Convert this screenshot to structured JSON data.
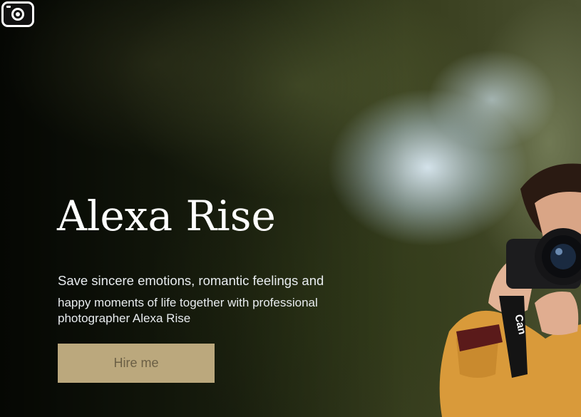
{
  "hero": {
    "title": "Alexa Rise",
    "lead_line1": "Save sincere emotions, romantic feelings and",
    "lead_line2": "happy moments of life together with professional photographer Alexa Rise",
    "cta_label": "Hire me",
    "camera_brand": "Can"
  },
  "icons": {
    "logo": "camera-icon"
  },
  "colors": {
    "button_bg": "#bba87d",
    "button_text": "#6b5f45",
    "title": "#ffffff"
  }
}
